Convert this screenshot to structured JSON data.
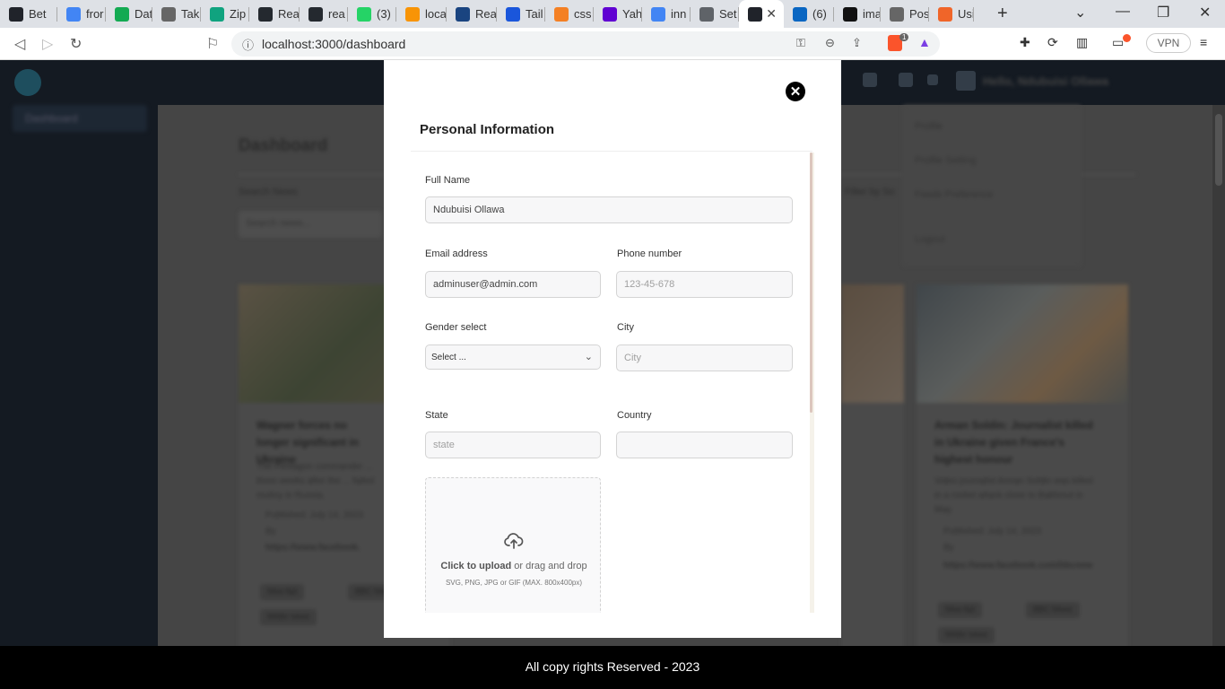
{
  "browser": {
    "tabs": [
      {
        "label": "Bet",
        "color": "#20232a"
      },
      {
        "label": "fror",
        "color": "#4285f4"
      },
      {
        "label": "Dat",
        "color": "#13aa52"
      },
      {
        "label": "Tak",
        "color": "#666666"
      },
      {
        "label": "Zip",
        "color": "#10a37f"
      },
      {
        "label": "Rea",
        "color": "#24292f"
      },
      {
        "label": "rea",
        "color": "#24292f"
      },
      {
        "label": "(3) ",
        "color": "#25d366"
      },
      {
        "label": "loca",
        "color": "#f89406"
      },
      {
        "label": "Rea",
        "color": "#1a4480"
      },
      {
        "label": "Tail",
        "color": "#1a56db"
      },
      {
        "label": "css",
        "color": "#f48024"
      },
      {
        "label": "Yah",
        "color": "#6001d2"
      },
      {
        "label": "inn",
        "color": "#4285f4"
      },
      {
        "label": "Set",
        "color": "#5f6368"
      },
      {
        "label": "",
        "color": "#20232a"
      },
      {
        "label": "(6)",
        "color": "#0a66c2"
      },
      {
        "label": "ima",
        "color": "#111111"
      },
      {
        "label": "Pos",
        "color": "#666666"
      },
      {
        "label": "Usi",
        "color": "#f06529"
      }
    ],
    "url": "localhost:3000/dashboard",
    "vpn_label": "VPN",
    "brave_badge": "1"
  },
  "app": {
    "sidebar_item": "Dashboard",
    "dashboard_title": "Dashboard",
    "search_label": "Search News",
    "search_placeholder": "Search news...",
    "filter_label": "Filter by So",
    "user_name": "Ndubuisi Ollawa",
    "user_greeting": "Hello,",
    "profile_menu": [
      "Profile",
      "Profile Setting",
      "Feeds Preference",
      "Logout"
    ],
    "cards": [
      {
        "title": "Wagner forces no longer significant in Ukraine",
        "body": "The Pentagon commander ... three weeks after the ... failed mutiny in Russia.",
        "published": "Published: July 14, 2023",
        "by": "By",
        "link": "https://www.facebook.",
        "tags": [
          "New Apl",
          "BBC News",
          "Wider news"
        ]
      },
      {
        "title": "Arman Soldin: Journalist killed in Ukraine given France's highest honour",
        "body": "Video journalist Arman Soldin was killed in a rocket attack close to Bakhmut in May.",
        "published": "Published: July 14, 2023",
        "by": "By",
        "link": "https://www.facebook.com/bbcnew",
        "tags": [
          "New Apl",
          "BBC News",
          "Wider news"
        ]
      }
    ],
    "footer": "All copy rights Reserved - 2023"
  },
  "modal": {
    "title": "Personal Information",
    "close_icon": "✕",
    "fields": {
      "full_name": {
        "label": "Full Name",
        "value": "Ndubuisi Ollawa"
      },
      "email": {
        "label": "Email address",
        "value": "adminuser@admin.com"
      },
      "phone": {
        "label": "Phone number",
        "placeholder": "123-45-678"
      },
      "gender": {
        "label": "Gender select",
        "value": "Select ..."
      },
      "city": {
        "label": "City",
        "placeholder": "City"
      },
      "state": {
        "label": "State",
        "placeholder": "state"
      },
      "country": {
        "label": "Country",
        "placeholder": ""
      }
    },
    "upload": {
      "strong": "Click to upload",
      "rest": " or drag and drop",
      "hint": "SVG, PNG, JPG or GIF (MAX. 800x400px)"
    }
  }
}
